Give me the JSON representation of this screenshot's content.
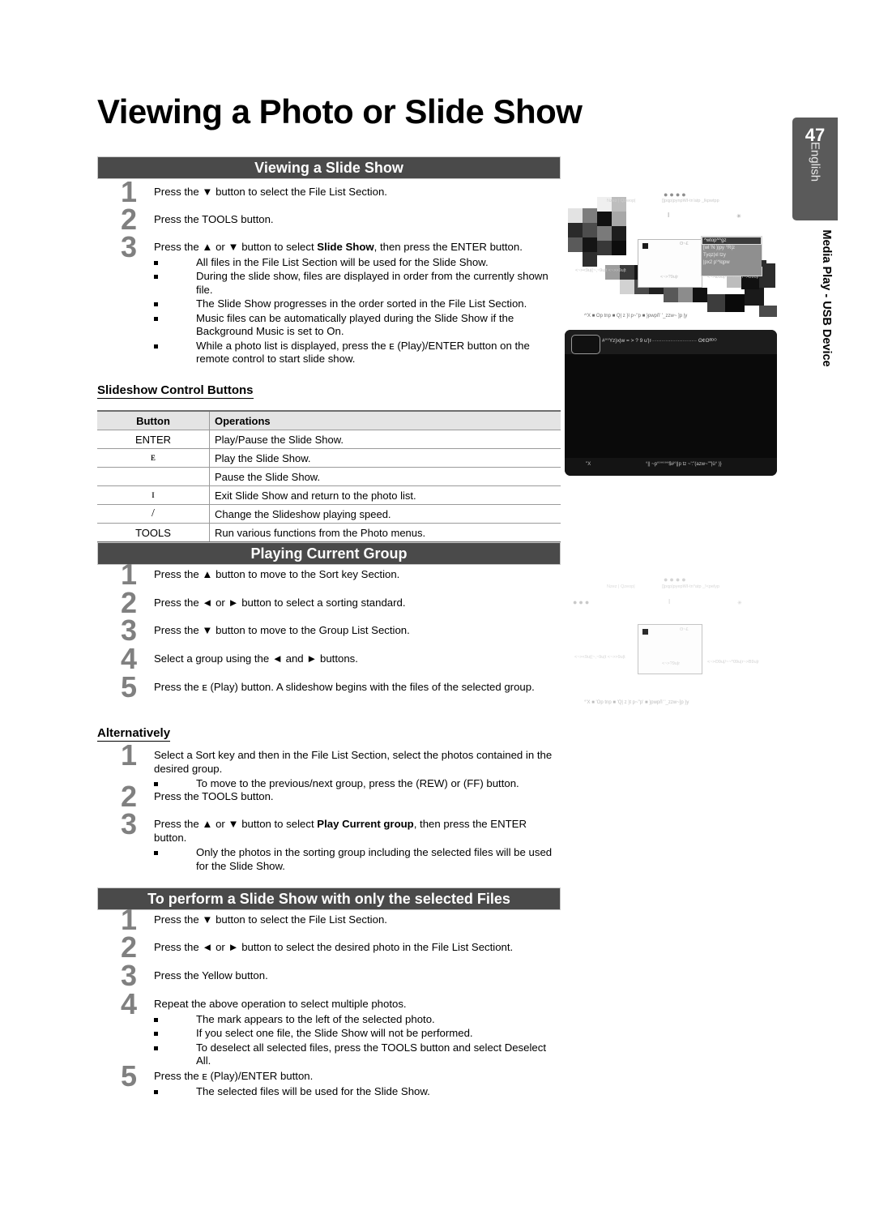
{
  "page": {
    "title": "Viewing a Photo or Slide Show",
    "number": "47",
    "language": "English",
    "side_caption": "Media Play - USB Device",
    "bar_color": "#4a4a4a",
    "tab_color": "#5a5a5a",
    "step_number_color": "#808080"
  },
  "sections": [
    {
      "heading": "Viewing a Slide Show",
      "steps": [
        {
          "num": "1",
          "text": "Press the ▼ button to select the File List Section.",
          "bullets": []
        },
        {
          "num": "2",
          "text": "Press the TOOLS button.",
          "bullets": []
        },
        {
          "num": "3",
          "text_parts": [
            "Press the ▲ or ▼ button to select ",
            "Slide Show",
            ", then press the ENTER button."
          ],
          "bullets": [
            "All files in the File List Section will be used for the Slide Show.",
            "During the slide show, files are displayed in order from the currently shown file.",
            "The Slide Show progresses in the order sorted in the File List Section.",
            "Music files can be automatically played during the Slide Show if the Background Music is set to On.",
            "While a photo list is displayed, press the ᴇ (Play)/ENTER button on the remote control to start slide show."
          ]
        }
      ]
    },
    {
      "heading": "Playing Current Group",
      "steps": [
        {
          "num": "1",
          "text": "Press the ▲ button to move to the Sort key Section."
        },
        {
          "num": "2",
          "text": "Press the ◄ or ► button to select a sorting standard."
        },
        {
          "num": "3",
          "text": "Press the ▼ button to move to the Group List Section."
        },
        {
          "num": "4",
          "text": "Select a group using the ◄ and ► buttons."
        },
        {
          "num": "5",
          "text": "Press the ᴇ (Play) button. A slideshow begins with the files of the selected group."
        }
      ]
    },
    {
      "heading": "To perform a Slide Show with only the selected Files",
      "steps": [
        {
          "num": "1",
          "text": "Press the ▼ button to select the File List Section."
        },
        {
          "num": "2",
          "text": "Press the ◄ or ► button to select the desired photo in the File List Sectiont."
        },
        {
          "num": "3",
          "text": "Press the Yellow button."
        },
        {
          "num": "4",
          "text": "Repeat the above operation to select multiple photos."
        },
        {
          "num": "5",
          "text": "Press the ᴇ (Play)/ENTER button."
        }
      ]
    }
  ],
  "slideshow_control": {
    "heading": "Slideshow Control Buttons",
    "columns": [
      "Button",
      "Operations"
    ],
    "rows": [
      {
        "button": "ENTER",
        "operation": "Play/Pause the Slide Show."
      },
      {
        "button": "ᴇ",
        "operation": "Play the Slide Show."
      },
      {
        "button": "",
        "operation": "Pause the Slide Show."
      },
      {
        "button": "ɪ",
        "operation": "Exit Slide Show and return to the photo list."
      },
      {
        "button": "/",
        "operation": "Change the Slideshow playing speed."
      },
      {
        "button": "TOOLS",
        "operation": "Run various functions from the Photo menus."
      }
    ]
  },
  "alternatively": {
    "heading": "Alternatively",
    "steps": [
      {
        "num": "1",
        "text": "Select a Sort key and then in the File List Section, select the photos contained in the desired group.",
        "bullets": [
          "To move to the previous/next group, press the (REW) or (FF) button."
        ]
      },
      {
        "num": "2",
        "text": "Press the TOOLS button.",
        "bullets": []
      },
      {
        "num": "3",
        "text_parts": [
          "Press the ▲ or ▼ button to select ",
          "Play Current group",
          ", then press the ENTER button."
        ],
        "bullets": [
          "Only the photos in the sorting group including the selected files will be used for the Slide Show."
        ]
      }
    ]
  },
  "selected_files_bullets": {
    "step4": [
      "The mark appears to the left of the selected photo.",
      "If you select one file, the Slide Show will not be performed.",
      "To deselect all selected files, press the TOOLS button and select Deselect All."
    ],
    "step5": [
      "The selected files will be used for the Slide Show."
    ]
  },
  "screenshots": {
    "shot1": {
      "top_labels": [
        "Nzez |   Qzwop|",
        "[]pqp|pynpWI-tn'atp _lkpwtpp"
      ],
      "menu_items": [
        "^wtop^^gz",
        "[wl 'Ñ )|py °R|z",
        "Tyqz|xl tzy",
        "|px2 p'^lqpw"
      ],
      "panel_label": "ʘ~£",
      "footer": "^'X  ■ Op tnp    ■ Q| z }l p~''p ■ }pwpñ' '_zzw~ ]p  |y"
    },
    "shot2": {
      "header_text": "#°°Yz}x|w = > ? 9 u'|r·························· ʘ¢ʘᴮᴰᴼ",
      "footer_left": "''X",
      "footer_right": "°|| ~p°°°°°°$#°||p tz ~':\"(azw~\"\"|ü° )}"
    },
    "shot3": {
      "top_labels": [
        "Nzez |   Qzeop|",
        "[]pqp|pyepWI-tn°atp _!<pelyp"
      ],
      "panel_label": "ʘ~£",
      "side_left": "<~><9u|(~,~9u|t <~>>9u|t",
      "side_center": "<~>?9u|r",
      "side_right": "<~>ʘ9u|/~~^09u|r~>B9u|r",
      "footer": "°'X  ■ 'Op tnp    ■ 'Q| z }t p~''p' ■ }pwpñ' '_zzw~]p  }y"
    }
  }
}
